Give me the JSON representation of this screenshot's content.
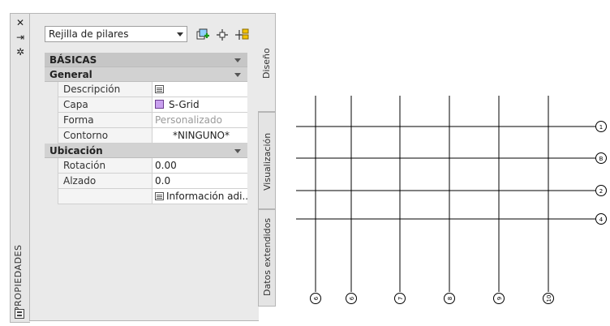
{
  "sidebar": {
    "label": "PROPIEDADES"
  },
  "toolbar": {
    "object_type": "Rejilla de pilares"
  },
  "tabs": [
    {
      "label": "Diseño",
      "active": true
    },
    {
      "label": "Visualización",
      "active": false
    },
    {
      "label": "Datos extendidos",
      "active": false
    }
  ],
  "sections": {
    "basicas": "BÁSICAS",
    "general": "General",
    "ubicacion": "Ubicación"
  },
  "properties": {
    "descripcion": {
      "name": "Descripción"
    },
    "capa": {
      "name": "Capa",
      "value": "S-Grid",
      "swatch_color": "#c9a0ef"
    },
    "forma": {
      "name": "Forma",
      "value": "Personalizado"
    },
    "contorno": {
      "name": "Contorno",
      "value": "*NINGUNO*"
    },
    "rotacion": {
      "name": "Rotación",
      "value": "0.00"
    },
    "alzado": {
      "name": "Alzado",
      "value": "0.0"
    },
    "info": {
      "value": "Información adi..."
    }
  },
  "icons": [
    "close-icon",
    "autohide-icon",
    "settings-icon",
    "add-selection-icon",
    "pickadd-icon",
    "quick-select-icon",
    "doc-icon",
    "properties-panel-icon"
  ],
  "grid": {
    "row_labels": [
      "1",
      "B",
      "2",
      "4"
    ],
    "column_labels": [
      "6",
      "6",
      "7",
      "8",
      "9",
      "10"
    ]
  }
}
